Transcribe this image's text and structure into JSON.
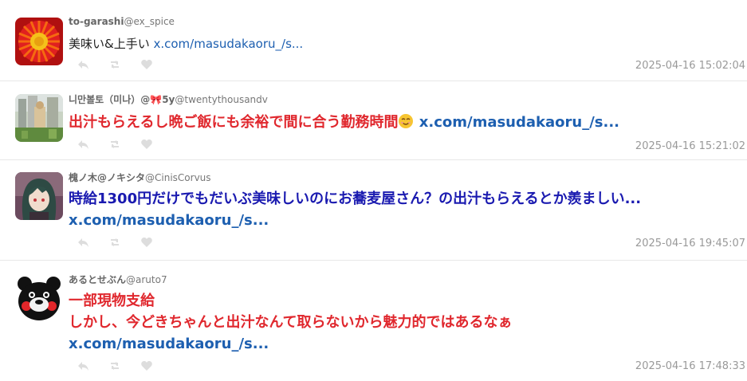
{
  "tweets": [
    {
      "display_name": "to-garashi",
      "handle": "@ex_spice",
      "text": "美味い&上手い",
      "link": "x.com/masudakaoru_/s...",
      "timestamp": "2025-04-16 15:02:04"
    },
    {
      "display_name": "니만볼토（미나）@",
      "display_name_tail": "5y",
      "handle": "@twentythousandv",
      "text": "出汁もらえるし晩ご飯にも余裕で間に合う勤務時間",
      "link": "x.com/masudakaoru_/s...",
      "timestamp": "2025-04-16 15:21:02"
    },
    {
      "display_name": "槐ノ木@ノキシタ",
      "handle": "@CinisCorvus",
      "text_part1": "時給1300円",
      "text_part2": "だけでもだいぶ美味しいのにお蕎麦屋さん？の出汁もらえるとか羨ましい...",
      "link": "x.com/masudakaoru_/s...",
      "timestamp": "2025-04-16 19:45:07"
    },
    {
      "display_name": "あるとせぶん",
      "handle": "@aruto7",
      "text_line1": "一部現物支給",
      "text_line2": "しかし、今どきちゃんと出汁なんて取らないから魅力的ではあるなぁ",
      "link": "x.com/masudakaoru_/s...",
      "timestamp": "2025-04-16 17:48:33"
    }
  ],
  "icons": {
    "reply": "reply-icon",
    "retweet": "retweet-icon",
    "like": "heart-icon"
  },
  "colors": {
    "red_text": "#e0282e",
    "blue_text": "#1a1ab0",
    "link": "#1d5fb0",
    "timestamp": "#999999"
  }
}
